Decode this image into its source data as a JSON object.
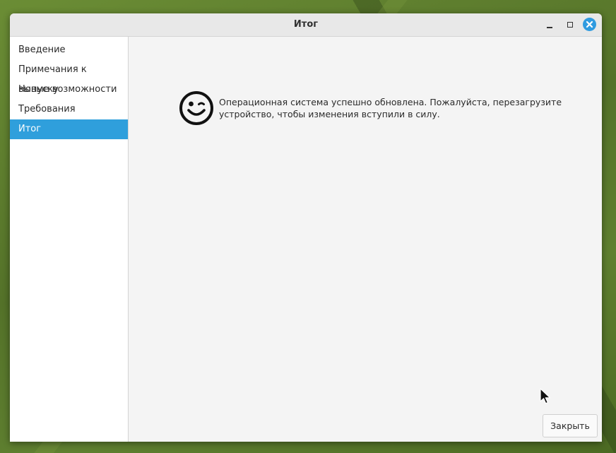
{
  "window": {
    "title": "Итог",
    "controls": {
      "minimize_icon": "minimize-icon",
      "maximize_icon": "maximize-icon",
      "close_icon": "close-icon",
      "close_color": "#2f9be0"
    }
  },
  "sidebar": {
    "items": [
      {
        "label": "Введение",
        "selected": false
      },
      {
        "label": "Примечания к выпуску",
        "selected": false
      },
      {
        "label": "Новые возможности",
        "selected": false
      },
      {
        "label": "Требования",
        "selected": false
      },
      {
        "label": "Итог",
        "selected": true
      }
    ],
    "selected_color": "#2f9fdc"
  },
  "main": {
    "icon": "wink-smiley-icon",
    "message": "Операционная система успешно обновлена. Пожалуйста, перезагрузите устройство, чтобы изменения вступили в силу."
  },
  "footer": {
    "close_label": "Закрыть"
  }
}
